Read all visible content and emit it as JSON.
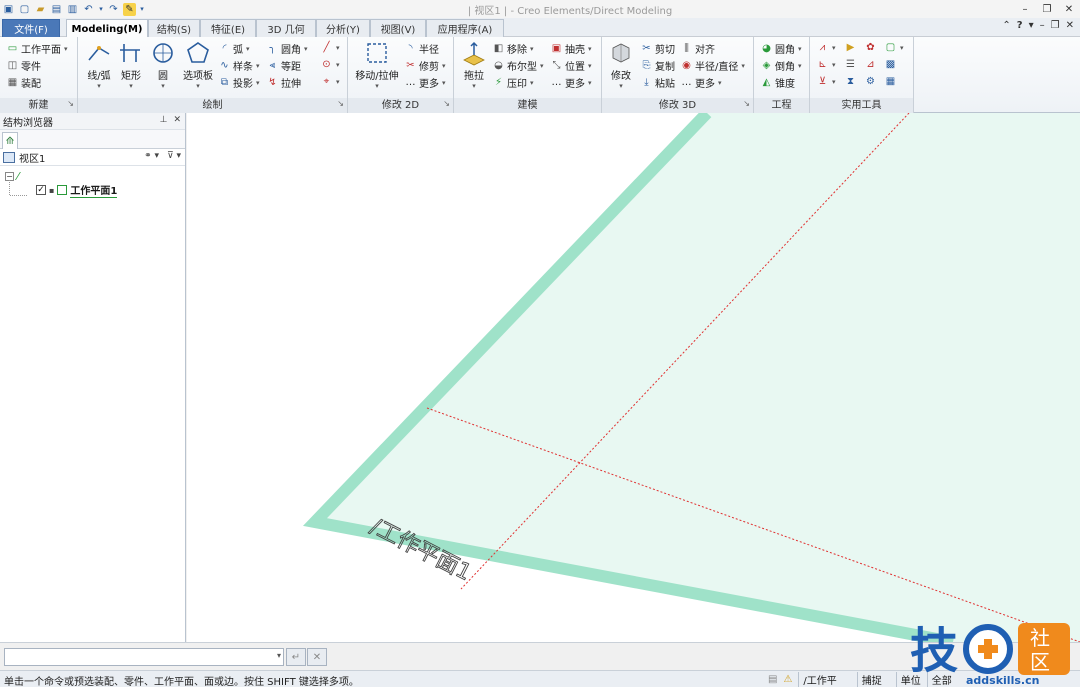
{
  "titlebar": {
    "title": "| 视区1 |  - Creo Elements/Direct Modeling",
    "qat_icons": [
      "app-icon",
      "new-icon",
      "open-icon",
      "save-icon",
      "save-as-icon",
      "undo-icon",
      "redo-icon",
      "highlight-icon",
      "customize-icon"
    ]
  },
  "tabs": [
    {
      "label": "文件(F)"
    },
    {
      "label": "Modeling(M)"
    },
    {
      "label": "结构(S)"
    },
    {
      "label": "特征(E)"
    },
    {
      "label": "3D 几何"
    },
    {
      "label": "分析(Y)"
    },
    {
      "label": "视图(V)"
    },
    {
      "label": "应用程序(A)"
    }
  ],
  "ribbon": {
    "new_group": {
      "label": "新建",
      "items": [
        "工作平面",
        "零件",
        "装配"
      ]
    },
    "draw_group": {
      "label": "绘制",
      "big": [
        "线/弧",
        "矩形",
        "圆",
        "选项板"
      ],
      "small": [
        "弧",
        "样条",
        "投影",
        "圆角",
        "等距",
        "拉伸"
      ]
    },
    "modify2d_group": {
      "label": "修改 2D",
      "big": [
        "移动/拉伸"
      ],
      "small": [
        "半径",
        "修剪",
        "更多"
      ]
    },
    "model_group": {
      "label": "建模",
      "big": [
        "拖拉"
      ],
      "small": [
        "移除",
        "布尔型",
        "压印",
        "抽壳",
        "位置",
        "更多"
      ]
    },
    "modify3d_group": {
      "label": "修改 3D",
      "big": [
        "修改"
      ],
      "small": [
        "剪切",
        "复制",
        "粘贴",
        "对齐",
        "半径/直径",
        "更多"
      ]
    },
    "eng_group": {
      "label": "工程",
      "small": [
        "圆角",
        "倒角",
        "锥度"
      ]
    },
    "util_group": {
      "label": "实用工具"
    }
  },
  "panel": {
    "title": "结构浏览器",
    "view_label": "视区1",
    "tree_item": "工作平面1"
  },
  "viewport": {
    "workplane_label": "/工作平面1"
  },
  "cmd": {
    "value": ""
  },
  "status": {
    "message": "单击一个命令或预选装配、零件、工作平面、面或边。按住 SHIFT 键选择多项。",
    "wp_label": "/工作平",
    "snap": "捕捉",
    "units": "单位",
    "all": "全部"
  },
  "watermark": {
    "char1": "技",
    "char2": "社",
    "char3": "区",
    "url": "addskills.cn"
  },
  "colors": {
    "plane_fill": "#e8f8f2",
    "plane_border": "#9fe2c9",
    "axis_red": "#e03030",
    "watermark_blue": "#1f5fb3",
    "watermark_orange": "#f08a1c"
  }
}
